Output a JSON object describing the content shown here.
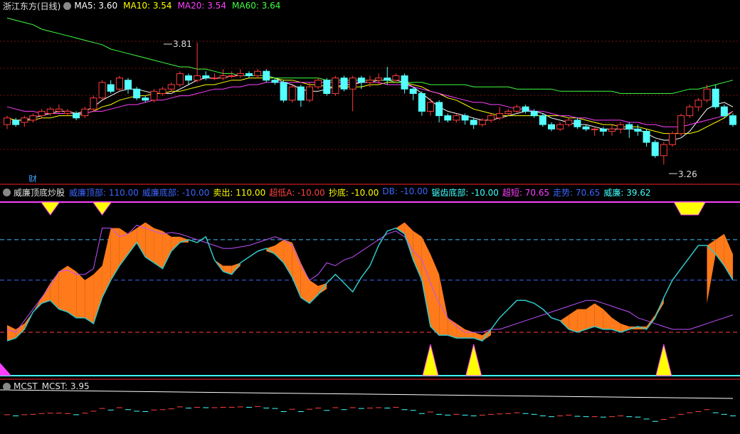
{
  "main_panel": {
    "title": "浙江东方(日线)",
    "ma": [
      {
        "label": "MA5: 3.60",
        "color": "#ffffff"
      },
      {
        "label": "MA10: 3.54",
        "color": "#ffff00"
      },
      {
        "label": "MA20: 3.54",
        "color": "#ff40ff"
      },
      {
        "label": "MA60: 3.64",
        "color": "#40ff40"
      }
    ],
    "high_marker": "3.81",
    "low_marker": "3.26",
    "cai_label": "财"
  },
  "osc_panel": {
    "title": "威廉顶底炒股",
    "items": [
      {
        "label": "威廉顶部: 110.00",
        "color": "#3c66ff"
      },
      {
        "label": "威廉底部: -10.00",
        "color": "#3c66ff"
      },
      {
        "label": "卖出: 110.00",
        "color": "#ffff00"
      },
      {
        "label": "超低A: -10.00",
        "color": "#ff4040"
      },
      {
        "label": "抄底: -10.00",
        "color": "#ffff00"
      },
      {
        "label": "DB: -10.00",
        "color": "#3c66ff"
      },
      {
        "label": "锯齿底部: -10.00",
        "color": "#40ffff"
      },
      {
        "label": "超短: 70.65",
        "color": "#ff40ff"
      },
      {
        "label": "走势: 70.65",
        "color": "#3c66ff"
      },
      {
        "label": "威廉: 39.62",
        "color": "#40ffff"
      }
    ]
  },
  "mcst_panel": {
    "title": "MCST",
    "value_label": "MCST: 3.95"
  },
  "chart_data": [
    {
      "type": "candlestick",
      "title": "浙江东方(日线)",
      "ylim": [
        3.26,
        3.81
      ],
      "candles": [
        [
          3.44,
          3.47,
          3.42,
          3.48
        ],
        [
          3.46,
          3.44,
          3.43,
          3.47
        ],
        [
          3.45,
          3.47,
          3.43,
          3.48
        ],
        [
          3.46,
          3.48,
          3.45,
          3.49
        ],
        [
          3.48,
          3.5,
          3.47,
          3.51
        ],
        [
          3.49,
          3.51,
          3.48,
          3.52
        ],
        [
          3.5,
          3.51,
          3.49,
          3.53
        ],
        [
          3.49,
          3.5,
          3.48,
          3.51
        ],
        [
          3.49,
          3.47,
          3.46,
          3.5
        ],
        [
          3.48,
          3.51,
          3.47,
          3.52
        ],
        [
          3.51,
          3.56,
          3.5,
          3.57
        ],
        [
          3.56,
          3.63,
          3.55,
          3.64
        ],
        [
          3.62,
          3.59,
          3.58,
          3.64
        ],
        [
          3.6,
          3.65,
          3.59,
          3.66
        ],
        [
          3.64,
          3.6,
          3.58,
          3.65
        ],
        [
          3.6,
          3.56,
          3.55,
          3.61
        ],
        [
          3.56,
          3.55,
          3.54,
          3.57
        ],
        [
          3.55,
          3.59,
          3.54,
          3.6
        ],
        [
          3.58,
          3.6,
          3.57,
          3.61
        ],
        [
          3.6,
          3.62,
          3.59,
          3.63
        ],
        [
          3.62,
          3.67,
          3.61,
          3.68
        ],
        [
          3.66,
          3.64,
          3.62,
          3.67
        ],
        [
          3.64,
          3.66,
          3.63,
          3.81
        ],
        [
          3.66,
          3.65,
          3.64,
          3.68
        ],
        [
          3.65,
          3.65,
          3.64,
          3.67
        ],
        [
          3.65,
          3.66,
          3.64,
          3.69
        ],
        [
          3.66,
          3.66,
          3.65,
          3.68
        ],
        [
          3.66,
          3.67,
          3.65,
          3.69
        ],
        [
          3.67,
          3.66,
          3.65,
          3.68
        ],
        [
          3.66,
          3.68,
          3.65,
          3.69
        ],
        [
          3.68,
          3.64,
          3.63,
          3.69
        ],
        [
          3.64,
          3.63,
          3.62,
          3.65
        ],
        [
          3.63,
          3.55,
          3.54,
          3.64
        ],
        [
          3.55,
          3.61,
          3.54,
          3.62
        ],
        [
          3.61,
          3.55,
          3.52,
          3.62
        ],
        [
          3.55,
          3.61,
          3.54,
          3.63
        ],
        [
          3.61,
          3.64,
          3.6,
          3.65
        ],
        [
          3.64,
          3.58,
          3.57,
          3.65
        ],
        [
          3.58,
          3.65,
          3.57,
          3.66
        ],
        [
          3.65,
          3.6,
          3.59,
          3.66
        ],
        [
          3.6,
          3.65,
          3.5,
          3.66
        ],
        [
          3.65,
          3.63,
          3.6,
          3.66
        ],
        [
          3.63,
          3.64,
          3.61,
          3.66
        ],
        [
          3.64,
          3.65,
          3.62,
          3.67
        ],
        [
          3.65,
          3.64,
          3.62,
          3.7
        ],
        [
          3.64,
          3.66,
          3.63,
          3.67
        ],
        [
          3.66,
          3.6,
          3.58,
          3.67
        ],
        [
          3.6,
          3.58,
          3.55,
          3.61
        ],
        [
          3.58,
          3.5,
          3.48,
          3.59
        ],
        [
          3.5,
          3.54,
          3.48,
          3.56
        ],
        [
          3.54,
          3.48,
          3.45,
          3.55
        ],
        [
          3.48,
          3.46,
          3.45,
          3.49
        ],
        [
          3.46,
          3.48,
          3.45,
          3.49
        ],
        [
          3.48,
          3.46,
          3.44,
          3.49
        ],
        [
          3.46,
          3.44,
          3.42,
          3.47
        ],
        [
          3.44,
          3.46,
          3.43,
          3.47
        ],
        [
          3.46,
          3.48,
          3.45,
          3.49
        ],
        [
          3.47,
          3.49,
          3.46,
          3.52
        ],
        [
          3.49,
          3.5,
          3.48,
          3.51
        ],
        [
          3.5,
          3.52,
          3.49,
          3.53
        ],
        [
          3.52,
          3.5,
          3.49,
          3.53
        ],
        [
          3.5,
          3.48,
          3.47,
          3.51
        ],
        [
          3.48,
          3.44,
          3.43,
          3.49
        ],
        [
          3.44,
          3.42,
          3.41,
          3.45
        ],
        [
          3.42,
          3.44,
          3.41,
          3.45
        ],
        [
          3.44,
          3.46,
          3.43,
          3.47
        ],
        [
          3.46,
          3.43,
          3.42,
          3.47
        ],
        [
          3.43,
          3.42,
          3.41,
          3.44
        ],
        [
          3.42,
          3.42,
          3.39,
          3.43
        ],
        [
          3.42,
          3.41,
          3.39,
          3.43
        ],
        [
          3.41,
          3.42,
          3.39,
          3.44
        ],
        [
          3.42,
          3.44,
          3.4,
          3.45
        ],
        [
          3.44,
          3.42,
          3.38,
          3.45
        ],
        [
          3.42,
          3.41,
          3.39,
          3.44
        ],
        [
          3.41,
          3.36,
          3.34,
          3.42
        ],
        [
          3.36,
          3.3,
          3.29,
          3.37
        ],
        [
          3.3,
          3.35,
          3.26,
          3.36
        ],
        [
          3.35,
          3.4,
          3.34,
          3.41
        ],
        [
          3.4,
          3.48,
          3.39,
          3.49
        ],
        [
          3.48,
          3.52,
          3.47,
          3.53
        ],
        [
          3.52,
          3.55,
          3.5,
          3.56
        ],
        [
          3.55,
          3.6,
          3.54,
          3.62
        ],
        [
          3.6,
          3.52,
          3.51,
          3.62
        ],
        [
          3.52,
          3.48,
          3.47,
          3.53
        ],
        [
          3.48,
          3.44,
          3.43,
          3.49
        ]
      ],
      "series": [
        {
          "name": "MA5",
          "values": [
            3.47,
            3.46,
            3.46,
            3.47,
            3.48,
            3.49,
            3.5,
            3.5,
            3.49,
            3.5,
            3.52,
            3.55,
            3.57,
            3.59,
            3.6,
            3.6,
            3.59,
            3.58,
            3.58,
            3.58,
            3.6,
            3.62,
            3.64,
            3.65,
            3.65,
            3.65,
            3.66,
            3.66,
            3.66,
            3.66,
            3.66,
            3.65,
            3.63,
            3.62,
            3.6,
            3.59,
            3.59,
            3.6,
            3.61,
            3.62,
            3.62,
            3.63,
            3.63,
            3.64,
            3.64,
            3.64,
            3.63,
            3.61,
            3.58,
            3.55,
            3.52,
            3.5,
            3.49,
            3.48,
            3.47,
            3.46,
            3.46,
            3.47,
            3.48,
            3.49,
            3.5,
            3.5,
            3.49,
            3.47,
            3.46,
            3.45,
            3.44,
            3.44,
            3.43,
            3.42,
            3.42,
            3.42,
            3.42,
            3.42,
            3.4,
            3.38,
            3.37,
            3.37,
            3.38,
            3.41,
            3.46,
            3.51,
            3.53,
            3.54,
            3.52
          ]
        },
        {
          "name": "MA10",
          "values": [
            3.47,
            3.46,
            3.46,
            3.46,
            3.47,
            3.47,
            3.48,
            3.48,
            3.48,
            3.49,
            3.5,
            3.52,
            3.53,
            3.55,
            3.56,
            3.57,
            3.57,
            3.58,
            3.58,
            3.59,
            3.59,
            3.6,
            3.61,
            3.62,
            3.62,
            3.63,
            3.64,
            3.64,
            3.65,
            3.65,
            3.65,
            3.65,
            3.64,
            3.64,
            3.63,
            3.62,
            3.62,
            3.61,
            3.61,
            3.61,
            3.61,
            3.61,
            3.62,
            3.62,
            3.63,
            3.63,
            3.63,
            3.62,
            3.61,
            3.59,
            3.58,
            3.56,
            3.55,
            3.53,
            3.51,
            3.5,
            3.49,
            3.48,
            3.48,
            3.48,
            3.48,
            3.48,
            3.48,
            3.48,
            3.48,
            3.47,
            3.47,
            3.46,
            3.45,
            3.44,
            3.44,
            3.43,
            3.43,
            3.43,
            3.42,
            3.41,
            3.4,
            3.4,
            3.4,
            3.4,
            3.41,
            3.43,
            3.45,
            3.47,
            3.5
          ]
        },
        {
          "name": "MA20",
          "values": [
            3.52,
            3.51,
            3.5,
            3.5,
            3.49,
            3.49,
            3.49,
            3.49,
            3.49,
            3.49,
            3.5,
            3.5,
            3.51,
            3.52,
            3.53,
            3.53,
            3.54,
            3.55,
            3.55,
            3.56,
            3.57,
            3.57,
            3.58,
            3.59,
            3.6,
            3.6,
            3.61,
            3.61,
            3.62,
            3.62,
            3.63,
            3.63,
            3.63,
            3.63,
            3.63,
            3.63,
            3.63,
            3.63,
            3.63,
            3.63,
            3.63,
            3.63,
            3.63,
            3.63,
            3.62,
            3.62,
            3.62,
            3.61,
            3.6,
            3.59,
            3.58,
            3.57,
            3.56,
            3.55,
            3.54,
            3.54,
            3.53,
            3.53,
            3.52,
            3.51,
            3.51,
            3.5,
            3.5,
            3.49,
            3.48,
            3.48,
            3.47,
            3.47,
            3.46,
            3.46,
            3.46,
            3.46,
            3.45,
            3.45,
            3.44,
            3.44,
            3.43,
            3.43,
            3.43,
            3.44,
            3.45,
            3.46,
            3.47,
            3.48,
            3.5
          ]
        },
        {
          "name": "MA60",
          "values": [
            3.92,
            3.91,
            3.9,
            3.89,
            3.87,
            3.86,
            3.85,
            3.84,
            3.83,
            3.82,
            3.81,
            3.8,
            3.78,
            3.77,
            3.76,
            3.75,
            3.74,
            3.73,
            3.72,
            3.71,
            3.7,
            3.7,
            3.69,
            3.69,
            3.68,
            3.67,
            3.67,
            3.66,
            3.66,
            3.66,
            3.66,
            3.65,
            3.65,
            3.65,
            3.65,
            3.65,
            3.65,
            3.64,
            3.64,
            3.64,
            3.64,
            3.64,
            3.64,
            3.64,
            3.64,
            3.63,
            3.63,
            3.63,
            3.63,
            3.62,
            3.62,
            3.62,
            3.62,
            3.62,
            3.61,
            3.61,
            3.61,
            3.61,
            3.61,
            3.6,
            3.6,
            3.6,
            3.6,
            3.6,
            3.59,
            3.59,
            3.59,
            3.59,
            3.59,
            3.59,
            3.59,
            3.58,
            3.58,
            3.58,
            3.58,
            3.58,
            3.58,
            3.58,
            3.59,
            3.6,
            3.6,
            3.61,
            3.62,
            3.63,
            3.64
          ]
        }
      ]
    },
    {
      "type": "line",
      "title": "威廉顶底炒股",
      "ylim": [
        -10,
        110
      ],
      "series": [
        {
          "name": "超短",
          "values": [
            22,
            20,
            28,
            36,
            44,
            52,
            62,
            63,
            60,
            60,
            64,
            92,
            92,
            86,
            88,
            94,
            92,
            90,
            88,
            89,
            88,
            86,
            84,
            82,
            80,
            78,
            78,
            79,
            80,
            82,
            84,
            86,
            84,
            80,
            66,
            56,
            60,
            68,
            66,
            70,
            72,
            76,
            80,
            84,
            88,
            90,
            86,
            76,
            70,
            54,
            40,
            30,
            24,
            20,
            20,
            20,
            22,
            22,
            24,
            26,
            28,
            30,
            32,
            34,
            36,
            38,
            40,
            42,
            42,
            40,
            38,
            36,
            34,
            30,
            28,
            26,
            24,
            22,
            22,
            22,
            24,
            26,
            28,
            30,
            32
          ]
        },
        {
          "name": "走势",
          "values": [
            25,
            22,
            26,
            34,
            44,
            54,
            62,
            66,
            62,
            56,
            60,
            66,
            92,
            92,
            88,
            92,
            96,
            92,
            90,
            86,
            86,
            82,
            78,
            74,
            70,
            66,
            66,
            66,
            68,
            70,
            76,
            80,
            84,
            82,
            68,
            56,
            52,
            50,
            46,
            44,
            46,
            50,
            58,
            70,
            82,
            92,
            96,
            90,
            86,
            74,
            60,
            30,
            26,
            22,
            20,
            18,
            18,
            20,
            22,
            26,
            30,
            30,
            28,
            26,
            28,
            32,
            36,
            36,
            40,
            36,
            30,
            26,
            24,
            22,
            24,
            32,
            40,
            30,
            26,
            30,
            34,
            40,
            84,
            88,
            74
          ]
        },
        {
          "name": "威廉",
          "values": [
            14,
            16,
            22,
            34,
            40,
            42,
            36,
            34,
            30,
            30,
            26,
            44,
            56,
            66,
            74,
            82,
            72,
            68,
            64,
            76,
            82,
            84,
            82,
            86,
            70,
            62,
            60,
            68,
            72,
            76,
            78,
            74,
            68,
            58,
            44,
            40,
            46,
            54,
            60,
            54,
            48,
            58,
            66,
            80,
            90,
            92,
            88,
            70,
            56,
            24,
            18,
            18,
            16,
            16,
            16,
            14,
            22,
            30,
            36,
            42,
            42,
            40,
            36,
            30,
            28,
            22,
            20,
            22,
            24,
            22,
            22,
            20,
            22,
            24,
            22,
            30,
            44,
            56,
            64,
            72,
            80,
            80,
            74,
            66,
            56
          ]
        }
      ]
    },
    {
      "type": "line",
      "title": "MCST",
      "series": [
        {
          "name": "MCST",
          "values": [
            3.95
          ]
        }
      ]
    }
  ]
}
